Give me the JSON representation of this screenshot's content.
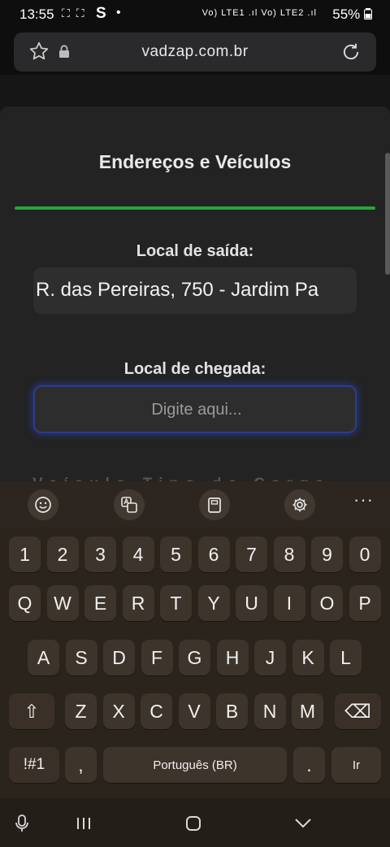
{
  "status_bar": {
    "time": "13:55",
    "notif_icons": "⛶ ⛶",
    "s_logo": "S",
    "dot": "•",
    "network": "Vo) LTE1 .ıl Vo) LTE2 .ıl",
    "battery": "55%"
  },
  "browser": {
    "url": "vadzap.com.br"
  },
  "page": {
    "title": "Endereços e Veículos",
    "origin_label": "Local de saída:",
    "origin_value": "R. das Pereiras, 750 - Jardim Pa",
    "destination_label": "Local de chegada:",
    "destination_value": "",
    "destination_placeholder": "Digite aqui...",
    "obscured_text": "Veículo Tipo de Carga"
  },
  "keyboard": {
    "toolbar_more": "···",
    "row_numbers": [
      "1",
      "2",
      "3",
      "4",
      "5",
      "6",
      "7",
      "8",
      "9",
      "0"
    ],
    "row_q": [
      "Q",
      "W",
      "E",
      "R",
      "T",
      "Y",
      "U",
      "I",
      "O",
      "P"
    ],
    "row_a": [
      "A",
      "S",
      "D",
      "F",
      "G",
      "H",
      "J",
      "K",
      "L"
    ],
    "row_z": [
      "Z",
      "X",
      "C",
      "V",
      "B",
      "N",
      "M"
    ],
    "shift": "⇧",
    "backspace": "⌫",
    "symbols": "!#1",
    "comma": ",",
    "space": "Português (BR)",
    "period": ".",
    "enter": "Ir"
  },
  "accent_colors": {
    "progress_line": "#22a83a",
    "focus_ring": "#2c3c88"
  }
}
